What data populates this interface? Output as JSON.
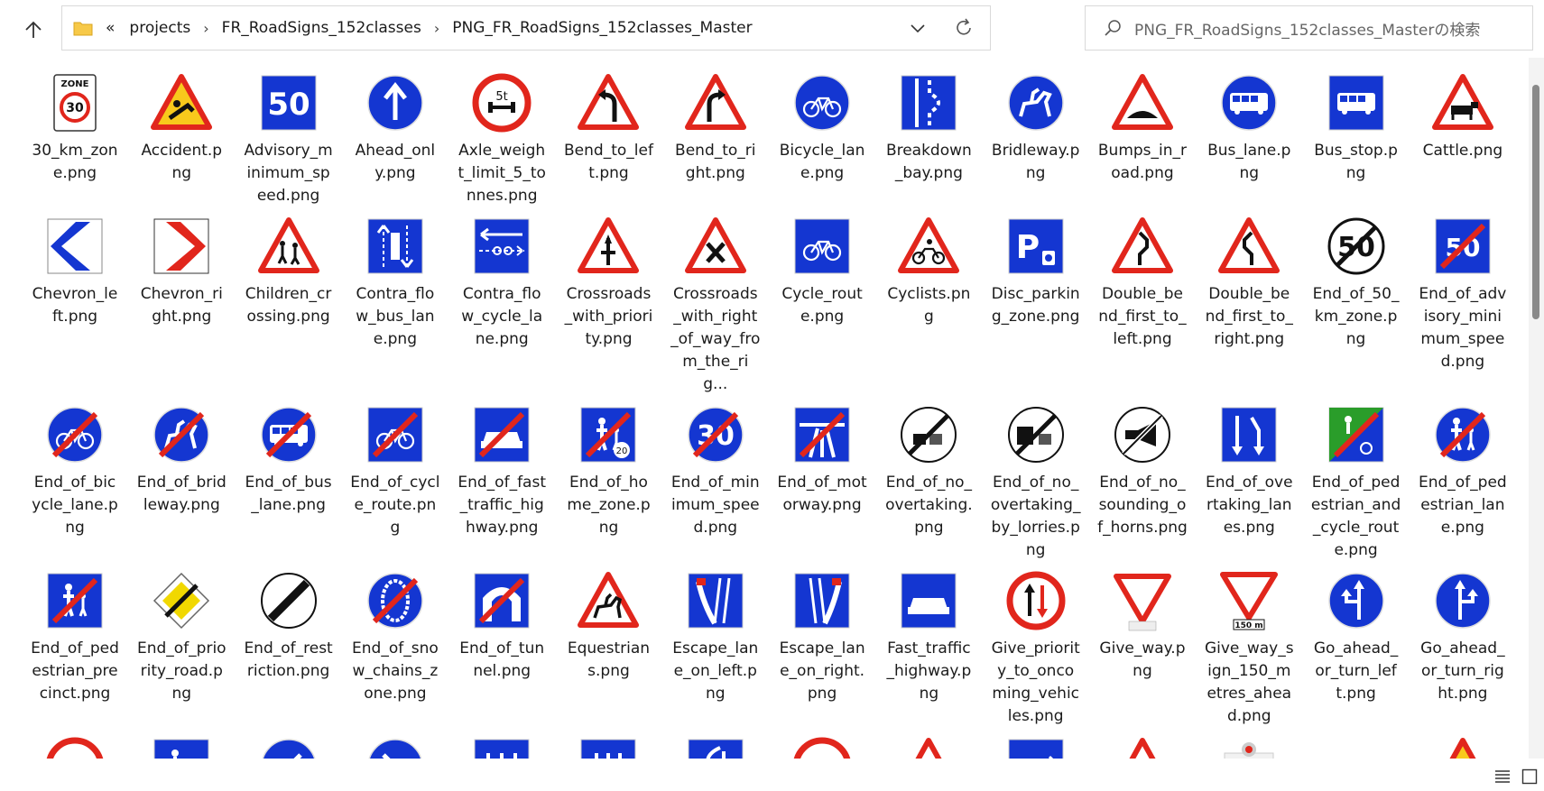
{
  "addressbar": {
    "overflow": "«",
    "crumbs": [
      "projects",
      "FR_RoadSigns_152classes",
      "PNG_FR_RoadSigns_152classes_Master"
    ]
  },
  "search": {
    "placeholder": "PNG_FR_RoadSigns_152classes_Masterの検索"
  },
  "files": [
    {
      "name": "30_km_zone.png",
      "icon": "zone30"
    },
    {
      "name": "Accident.png",
      "icon": "accident"
    },
    {
      "name": "Advisory_minimum_speed.png",
      "icon": "advisory50"
    },
    {
      "name": "Ahead_only.png",
      "icon": "ahead"
    },
    {
      "name": "Axle_weight_limit_5_tonnes.png",
      "icon": "axle5t"
    },
    {
      "name": "Bend_to_left.png",
      "icon": "bendleft"
    },
    {
      "name": "Bend_to_right.png",
      "icon": "bendright"
    },
    {
      "name": "Bicycle_lane.png",
      "icon": "bicyclelane"
    },
    {
      "name": "Breakdown_bay.png",
      "icon": "breakdown"
    },
    {
      "name": "Bridleway.png",
      "icon": "bridleway"
    },
    {
      "name": "Bumps_in_road.png",
      "icon": "bumps"
    },
    {
      "name": "Bus_lane.png",
      "icon": "buslane"
    },
    {
      "name": "Bus_stop.png",
      "icon": "busstop"
    },
    {
      "name": "Cattle.png",
      "icon": "cattle"
    },
    {
      "name": "Chevron_left.png",
      "icon": "chevleft"
    },
    {
      "name": "Chevron_right.png",
      "icon": "chevright"
    },
    {
      "name": "Children_crossing.png",
      "icon": "children"
    },
    {
      "name": "Contra_flow_bus_lane.png",
      "icon": "contrabus"
    },
    {
      "name": "Contra_flow_cycle_lane.png",
      "icon": "contracycle"
    },
    {
      "name": "Crossroads_with_priority.png",
      "icon": "crosspriority"
    },
    {
      "name": "Crossroads_with_right_of_way_from_the_rig...",
      "icon": "crossright"
    },
    {
      "name": "Cycle_route.png",
      "icon": "cycleroute"
    },
    {
      "name": "Cyclists.png",
      "icon": "cyclists"
    },
    {
      "name": "Disc_parking_zone.png",
      "icon": "discparking"
    },
    {
      "name": "Double_bend_first_to_left.png",
      "icon": "dblleft"
    },
    {
      "name": "Double_bend_first_to_right.png",
      "icon": "dblright"
    },
    {
      "name": "End_of_50_km_zone.png",
      "icon": "end50"
    },
    {
      "name": "End_of_advisory_minimum_speed.png",
      "icon": "endadv50"
    },
    {
      "name": "End_of_bicycle_lane.png",
      "icon": "endbicycle"
    },
    {
      "name": "End_of_bridleway.png",
      "icon": "endbridle"
    },
    {
      "name": "End_of_bus_lane.png",
      "icon": "endbus"
    },
    {
      "name": "End_of_cycle_route.png",
      "icon": "endcycleroute"
    },
    {
      "name": "End_of_fast_traffic_highway.png",
      "icon": "endfast"
    },
    {
      "name": "End_of_home_zone.png",
      "icon": "endhome"
    },
    {
      "name": "End_of_minimum_speed.png",
      "icon": "endmin30"
    },
    {
      "name": "End_of_motorway.png",
      "icon": "endmotorway"
    },
    {
      "name": "End_of_no_overtaking.png",
      "icon": "endnoovertake"
    },
    {
      "name": "End_of_no_overtaking_by_lorries.png",
      "icon": "endnoovertakelorry"
    },
    {
      "name": "End_of_no_sounding_of_horns.png",
      "icon": "endhorn"
    },
    {
      "name": "End_of_overtaking_lanes.png",
      "icon": "endovertakelanes"
    },
    {
      "name": "End_of_pedestrian_and_cycle_route.png",
      "icon": "endpedcycle"
    },
    {
      "name": "End_of_pedestrian_lane.png",
      "icon": "endpedlane"
    },
    {
      "name": "End_of_pedestrian_precinct.png",
      "icon": "endpedprecinct"
    },
    {
      "name": "End_of_priority_road.png",
      "icon": "endpriority"
    },
    {
      "name": "End_of_restriction.png",
      "icon": "endrestriction"
    },
    {
      "name": "End_of_snow_chains_zone.png",
      "icon": "endsnow"
    },
    {
      "name": "End_of_tunnel.png",
      "icon": "endtunnel"
    },
    {
      "name": "Equestrians.png",
      "icon": "equestrians"
    },
    {
      "name": "Escape_lane_on_left.png",
      "icon": "escapeleft"
    },
    {
      "name": "Escape_lane_on_right.png",
      "icon": "escaperight"
    },
    {
      "name": "Fast_traffic_highway.png",
      "icon": "fasttraffic"
    },
    {
      "name": "Give_priority_to_oncoming_vehicles.png",
      "icon": "givepriority"
    },
    {
      "name": "Give_way.png",
      "icon": "giveway"
    },
    {
      "name": "Give_way_sign_150_metres_ahead.png",
      "icon": "giveway150"
    },
    {
      "name": "Go_ahead_or_turn_left.png",
      "icon": "goleft"
    },
    {
      "name": "Go_ahead_or_turn_right.png",
      "icon": "goright"
    },
    {
      "name": "",
      "icon": "height35"
    },
    {
      "name": "",
      "icon": "homezone20"
    },
    {
      "name": "",
      "icon": "keepleft"
    },
    {
      "name": "",
      "icon": "keepright"
    },
    {
      "name": "",
      "icon": "lanes3"
    },
    {
      "name": "",
      "icon": "lanes3b"
    },
    {
      "name": "",
      "icon": "lanemerge"
    },
    {
      "name": "",
      "icon": "lorry10m"
    },
    {
      "name": "",
      "icon": "levelcrossing"
    },
    {
      "name": "",
      "icon": "deadendarrow"
    },
    {
      "name": "",
      "icon": "train"
    },
    {
      "name": "",
      "icon": "crossingsignal"
    },
    {
      "name": "",
      "icon": "barrier"
    },
    {
      "name": "",
      "icon": "slippery"
    }
  ]
}
